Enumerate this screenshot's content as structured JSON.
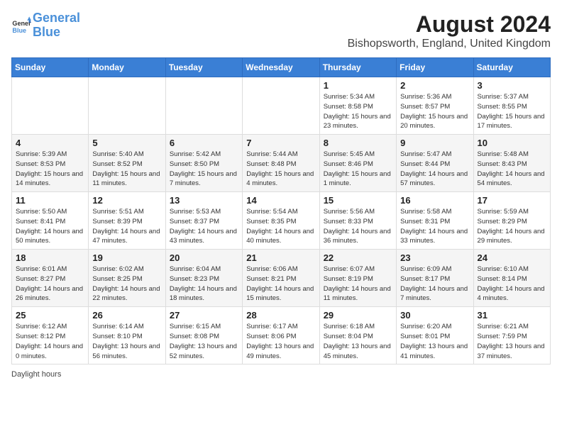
{
  "header": {
    "logo_line1": "General",
    "logo_line2": "Blue",
    "month_year": "August 2024",
    "location": "Bishopsworth, England, United Kingdom"
  },
  "days_of_week": [
    "Sunday",
    "Monday",
    "Tuesday",
    "Wednesday",
    "Thursday",
    "Friday",
    "Saturday"
  ],
  "weeks": [
    [
      {
        "day": "",
        "info": ""
      },
      {
        "day": "",
        "info": ""
      },
      {
        "day": "",
        "info": ""
      },
      {
        "day": "",
        "info": ""
      },
      {
        "day": "1",
        "info": "Sunrise: 5:34 AM\nSunset: 8:58 PM\nDaylight: 15 hours and 23 minutes."
      },
      {
        "day": "2",
        "info": "Sunrise: 5:36 AM\nSunset: 8:57 PM\nDaylight: 15 hours and 20 minutes."
      },
      {
        "day": "3",
        "info": "Sunrise: 5:37 AM\nSunset: 8:55 PM\nDaylight: 15 hours and 17 minutes."
      }
    ],
    [
      {
        "day": "4",
        "info": "Sunrise: 5:39 AM\nSunset: 8:53 PM\nDaylight: 15 hours and 14 minutes."
      },
      {
        "day": "5",
        "info": "Sunrise: 5:40 AM\nSunset: 8:52 PM\nDaylight: 15 hours and 11 minutes."
      },
      {
        "day": "6",
        "info": "Sunrise: 5:42 AM\nSunset: 8:50 PM\nDaylight: 15 hours and 7 minutes."
      },
      {
        "day": "7",
        "info": "Sunrise: 5:44 AM\nSunset: 8:48 PM\nDaylight: 15 hours and 4 minutes."
      },
      {
        "day": "8",
        "info": "Sunrise: 5:45 AM\nSunset: 8:46 PM\nDaylight: 15 hours and 1 minute."
      },
      {
        "day": "9",
        "info": "Sunrise: 5:47 AM\nSunset: 8:44 PM\nDaylight: 14 hours and 57 minutes."
      },
      {
        "day": "10",
        "info": "Sunrise: 5:48 AM\nSunset: 8:43 PM\nDaylight: 14 hours and 54 minutes."
      }
    ],
    [
      {
        "day": "11",
        "info": "Sunrise: 5:50 AM\nSunset: 8:41 PM\nDaylight: 14 hours and 50 minutes."
      },
      {
        "day": "12",
        "info": "Sunrise: 5:51 AM\nSunset: 8:39 PM\nDaylight: 14 hours and 47 minutes."
      },
      {
        "day": "13",
        "info": "Sunrise: 5:53 AM\nSunset: 8:37 PM\nDaylight: 14 hours and 43 minutes."
      },
      {
        "day": "14",
        "info": "Sunrise: 5:54 AM\nSunset: 8:35 PM\nDaylight: 14 hours and 40 minutes."
      },
      {
        "day": "15",
        "info": "Sunrise: 5:56 AM\nSunset: 8:33 PM\nDaylight: 14 hours and 36 minutes."
      },
      {
        "day": "16",
        "info": "Sunrise: 5:58 AM\nSunset: 8:31 PM\nDaylight: 14 hours and 33 minutes."
      },
      {
        "day": "17",
        "info": "Sunrise: 5:59 AM\nSunset: 8:29 PM\nDaylight: 14 hours and 29 minutes."
      }
    ],
    [
      {
        "day": "18",
        "info": "Sunrise: 6:01 AM\nSunset: 8:27 PM\nDaylight: 14 hours and 26 minutes."
      },
      {
        "day": "19",
        "info": "Sunrise: 6:02 AM\nSunset: 8:25 PM\nDaylight: 14 hours and 22 minutes."
      },
      {
        "day": "20",
        "info": "Sunrise: 6:04 AM\nSunset: 8:23 PM\nDaylight: 14 hours and 18 minutes."
      },
      {
        "day": "21",
        "info": "Sunrise: 6:06 AM\nSunset: 8:21 PM\nDaylight: 14 hours and 15 minutes."
      },
      {
        "day": "22",
        "info": "Sunrise: 6:07 AM\nSunset: 8:19 PM\nDaylight: 14 hours and 11 minutes."
      },
      {
        "day": "23",
        "info": "Sunrise: 6:09 AM\nSunset: 8:17 PM\nDaylight: 14 hours and 7 minutes."
      },
      {
        "day": "24",
        "info": "Sunrise: 6:10 AM\nSunset: 8:14 PM\nDaylight: 14 hours and 4 minutes."
      }
    ],
    [
      {
        "day": "25",
        "info": "Sunrise: 6:12 AM\nSunset: 8:12 PM\nDaylight: 14 hours and 0 minutes."
      },
      {
        "day": "26",
        "info": "Sunrise: 6:14 AM\nSunset: 8:10 PM\nDaylight: 13 hours and 56 minutes."
      },
      {
        "day": "27",
        "info": "Sunrise: 6:15 AM\nSunset: 8:08 PM\nDaylight: 13 hours and 52 minutes."
      },
      {
        "day": "28",
        "info": "Sunrise: 6:17 AM\nSunset: 8:06 PM\nDaylight: 13 hours and 49 minutes."
      },
      {
        "day": "29",
        "info": "Sunrise: 6:18 AM\nSunset: 8:04 PM\nDaylight: 13 hours and 45 minutes."
      },
      {
        "day": "30",
        "info": "Sunrise: 6:20 AM\nSunset: 8:01 PM\nDaylight: 13 hours and 41 minutes."
      },
      {
        "day": "31",
        "info": "Sunrise: 6:21 AM\nSunset: 7:59 PM\nDaylight: 13 hours and 37 minutes."
      }
    ]
  ],
  "footer": {
    "note": "Daylight hours"
  }
}
